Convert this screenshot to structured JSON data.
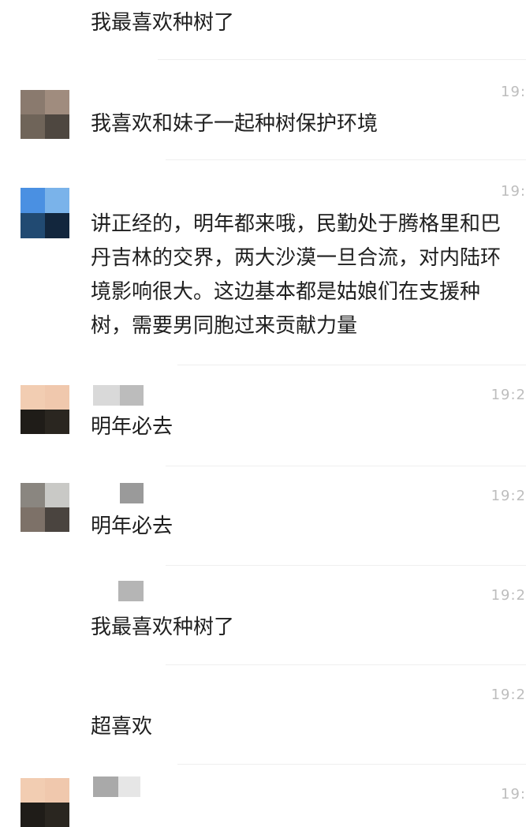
{
  "messages": [
    {
      "text": "我最喜欢种树了",
      "time": ""
    },
    {
      "text": "我喜欢和妹子一起种树保护环境",
      "time": "19:"
    },
    {
      "text": "讲正经的，明年都来哦，民勤处于腾格里和巴丹吉林的交界，两大沙漠一旦合流，对内陆环境影响很大。这边基本都是姑娘们在支援种树，需要男同胞过来贡献力量",
      "time": "19:"
    },
    {
      "text": "明年必去",
      "time": "19:2"
    },
    {
      "text": "明年必去",
      "time": "19:2"
    },
    {
      "text": "我最喜欢种树了",
      "time": "19:2"
    },
    {
      "text": "超喜欢",
      "time": "19:2"
    },
    {
      "text": "",
      "time": "19:"
    }
  ],
  "colors": {
    "background": "#ffffff",
    "text": "#1f1f1f",
    "time": "#bdbdbd",
    "divider": "#efefef"
  }
}
